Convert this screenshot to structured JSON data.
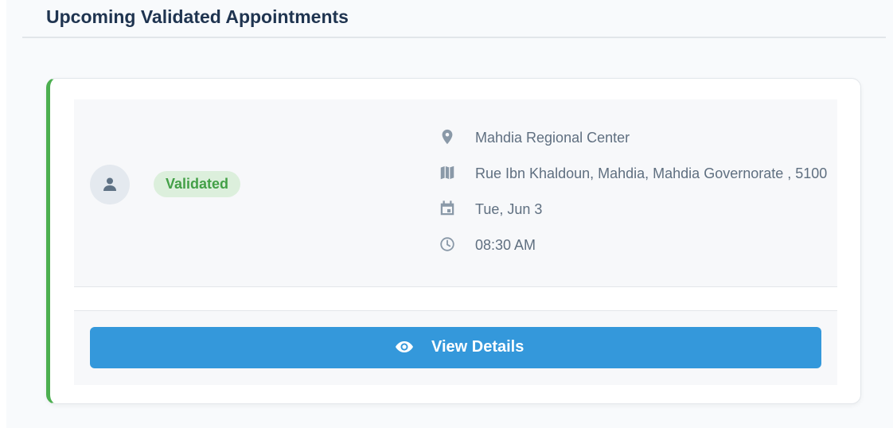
{
  "header": {
    "title": "Upcoming Validated Appointments"
  },
  "appointment": {
    "status": "Validated",
    "status_color": "#43a047",
    "accent_color": "#4caf50",
    "avatar_icon": "person-icon",
    "details": [
      {
        "icon": "location-pin-icon",
        "text": "Mahdia Regional Center"
      },
      {
        "icon": "map-icon",
        "text": "Rue Ibn Khaldoun, Mahdia, Mahdia Governorate , 5100"
      },
      {
        "icon": "calendar-icon",
        "text": "Tue, Jun 3"
      },
      {
        "icon": "clock-icon",
        "text": "08:30 AM"
      }
    ],
    "action": {
      "label": "View Details",
      "icon": "eye-icon",
      "color": "#3498db"
    }
  }
}
